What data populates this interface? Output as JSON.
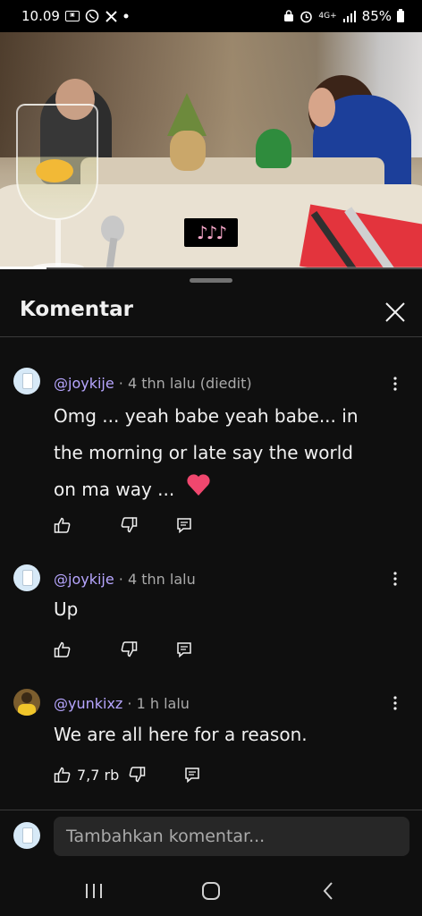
{
  "status_bar": {
    "time": "10.09",
    "network": "4G+",
    "battery": "85%",
    "icons": [
      "pointer-box-icon",
      "whatsapp-icon",
      "x-icon",
      "dot-icon",
      "lock-icon",
      "alarm-icon",
      "signal-icon",
      "battery-icon"
    ]
  },
  "video": {
    "music_badge": "♪♪♪",
    "progress": 0.11
  },
  "panel": {
    "title": "Komentar"
  },
  "comments": [
    {
      "handle": "@joykije",
      "meta": " · 4 thn lalu (diedit)",
      "text_lines": [
        "Omg ... yeah babe yeah babe... in",
        "the morning or late say the world",
        "on ma way ... "
      ],
      "emoji": "heart",
      "like_count": ""
    },
    {
      "handle": "@joykije",
      "meta": " · 4 thn lalu",
      "text_lines": [
        "Up"
      ],
      "like_count": ""
    },
    {
      "handle": "@yunkixz",
      "meta": " · 1 h lalu",
      "text_lines": [
        "We are all here for a reason."
      ],
      "like_count": "7,7 rb"
    }
  ],
  "compose": {
    "placeholder": "Tambahkan komentar..."
  },
  "colors": {
    "background": "#0f0f0f",
    "handle": "#b7a6ff",
    "heart": "#f0476e",
    "input_bg": "#272727"
  }
}
